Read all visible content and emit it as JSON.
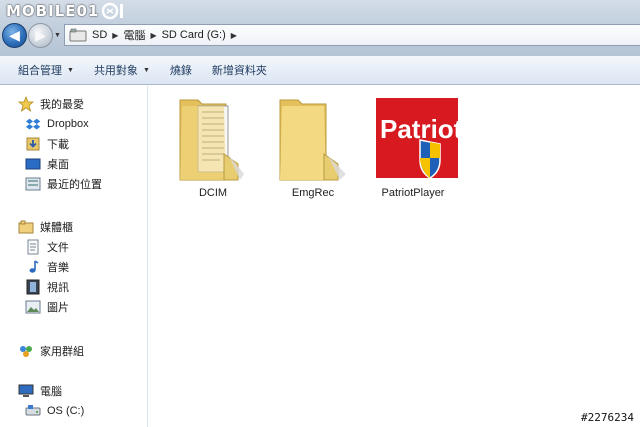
{
  "watermark": {
    "text": "MOBILE01"
  },
  "address_bar": {
    "crumbs": [
      "SD",
      "電腦",
      "SD Card (G:)"
    ]
  },
  "commands": {
    "organize": "組合管理",
    "share": "共用對象",
    "burn": "燒錄",
    "new_folder": "新增資料夾"
  },
  "nav_pane": {
    "favorites": {
      "label": "我的最愛",
      "items": [
        "Dropbox",
        "下載",
        "桌面",
        "最近的位置"
      ]
    },
    "libraries": {
      "label": "媒體櫃",
      "items": [
        "文件",
        "音樂",
        "視訊",
        "圖片"
      ]
    },
    "homegroup": {
      "label": "家用群組"
    },
    "computer": {
      "label": "電腦",
      "items": [
        "OS (C:)"
      ]
    }
  },
  "files": [
    {
      "name": "DCIM",
      "icon": "folder-with-documents-icon"
    },
    {
      "name": "EmgRec",
      "icon": "empty-folder-icon"
    },
    {
      "name": "PatriotPlayer",
      "icon": "patriot-app-icon",
      "brand_text": "Patriot"
    }
  ],
  "photo_id": "#2276234",
  "colors": {
    "folder": "#f3d77a",
    "patriot_red": "#d71920",
    "shield_blue": "#1e5fb8",
    "shield_yellow": "#f6c200"
  }
}
